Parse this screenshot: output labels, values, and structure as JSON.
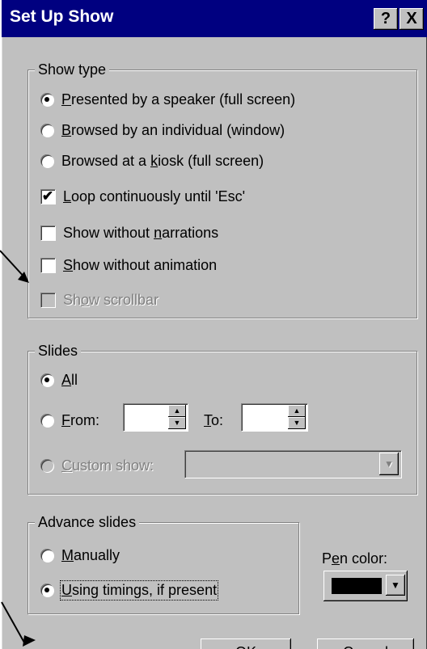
{
  "dialog": {
    "title": "Set Up Show",
    "help_button": "?",
    "close_button": "X"
  },
  "show_type": {
    "legend": "Show type",
    "options": [
      {
        "pre": "",
        "key": "P",
        "post": "resented by a speaker (full screen)",
        "selected": true
      },
      {
        "pre": "",
        "key": "B",
        "post": "rowsed by an individual (window)",
        "selected": false
      },
      {
        "pre": "Browsed at a ",
        "key": "k",
        "post": "iosk (full screen)",
        "selected": false
      }
    ],
    "checkboxes": [
      {
        "pre": "",
        "key": "L",
        "post": "oop continuously until 'Esc'",
        "checked": true,
        "enabled": true
      },
      {
        "pre": "Show without ",
        "key": "n",
        "post": "arrations",
        "checked": false,
        "enabled": true
      },
      {
        "pre": "",
        "key": "S",
        "post": "how without animation",
        "checked": false,
        "enabled": true
      },
      {
        "pre": "Sh",
        "key": "o",
        "post": "w scrollbar",
        "checked": false,
        "enabled": false
      }
    ]
  },
  "slides": {
    "legend": "Slides",
    "all": {
      "pre": "",
      "key": "A",
      "post": "ll",
      "selected": true
    },
    "from": {
      "pre": "",
      "key": "F",
      "post": "rom:",
      "selected": false,
      "value": ""
    },
    "to": {
      "pre": "",
      "key": "T",
      "post": "o:",
      "value": ""
    },
    "custom": {
      "pre": "",
      "key": "C",
      "post": "ustom show:",
      "selected": false,
      "enabled": false,
      "value": ""
    }
  },
  "advance": {
    "legend": "Advance slides",
    "manually": {
      "pre": "",
      "key": "M",
      "post": "anually",
      "selected": false
    },
    "timings": {
      "pre": "",
      "key": "U",
      "post": "sing timings, if present",
      "selected": true
    }
  },
  "pen_color": {
    "label_pre": "P",
    "label_key": "e",
    "label_post": "n color:",
    "color": "#000000"
  },
  "buttons": {
    "ok": "OK",
    "cancel": "Cancel"
  },
  "colors": {
    "title_bar": "#000080",
    "face": "#c0c0c0"
  }
}
